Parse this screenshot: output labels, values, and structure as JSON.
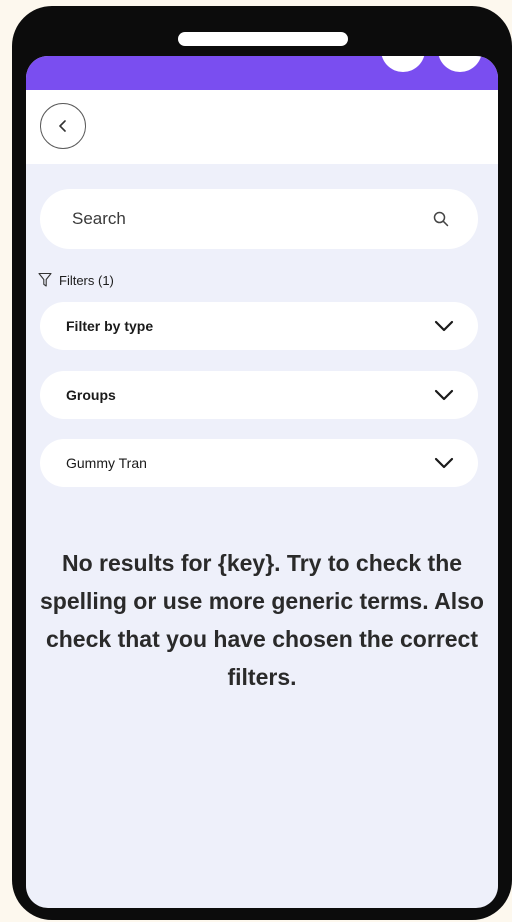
{
  "header": {
    "back_icon": "chevron-left-icon"
  },
  "search": {
    "placeholder": "Search",
    "value": "",
    "icon": "search-icon"
  },
  "filters": {
    "label": "Filters (1)",
    "icon": "filter-icon",
    "dropdowns": [
      {
        "label": "Filter by type",
        "icon": "chevron-down-icon"
      },
      {
        "label": "Groups",
        "icon": "chevron-down-icon"
      },
      {
        "label": "Gummy Tran",
        "icon": "chevron-down-icon"
      }
    ]
  },
  "empty_state": {
    "message": "No results for {key}. Try to check the spelling or use more generic terms. Also check that you have chosen the correct filters."
  },
  "colors": {
    "accent": "#7a4ef0",
    "screen_bg": "#eef0fa",
    "page_bg": "#fdf8ee",
    "device_frame": "#0c0c0c"
  }
}
